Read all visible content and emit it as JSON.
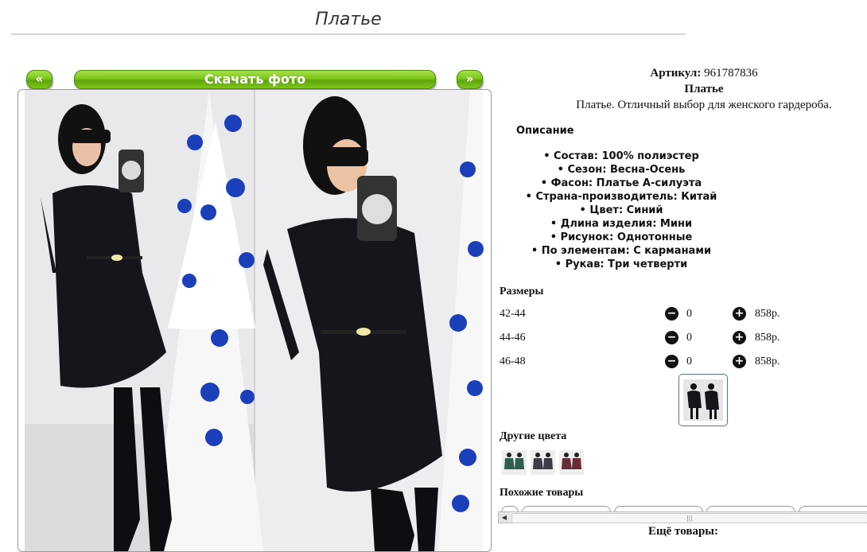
{
  "page": {
    "title": "Платье"
  },
  "gallery": {
    "prev_label": "«",
    "download_label": "Скачать фото",
    "next_label": "»"
  },
  "product": {
    "article_label": "Артикул:",
    "article_value": "961787836",
    "name": "Платье",
    "short_description": "Платье. Отличный выбор для женского гардероба.",
    "description_heading": "Описание",
    "specs": [
      "Состав: 100% полиэстер",
      "Сезон: Весна-Осень",
      "Фасон: Платье А-силуэта",
      "Страна-производитель: Китай",
      "Цвет: Синий",
      "Длина изделия: Мини",
      "Рисунок: Однотонные",
      "По элементам: С карманами",
      "Рукав: Три четверти"
    ]
  },
  "sizes": {
    "heading": "Размеры",
    "rows": [
      {
        "size": "42-44",
        "qty": "0",
        "price": "858р."
      },
      {
        "size": "44-46",
        "qty": "0",
        "price": "858р."
      },
      {
        "size": "46-48",
        "qty": "0",
        "price": "858р."
      }
    ],
    "minus_icon": "minus-circle-icon",
    "plus_icon": "plus-circle-icon"
  },
  "other_colors": {
    "heading": "Другие цвета",
    "swatch_colors": [
      "#2f5f4a",
      "#3d3d46",
      "#6a2a3a"
    ]
  },
  "similar": {
    "heading": "Похожие товары"
  },
  "more": {
    "heading": "Ещё товары:"
  },
  "colors": {
    "accent_green": "#7cc41a",
    "dress": "#15151b",
    "tree_ball": "#1b3fb8"
  }
}
